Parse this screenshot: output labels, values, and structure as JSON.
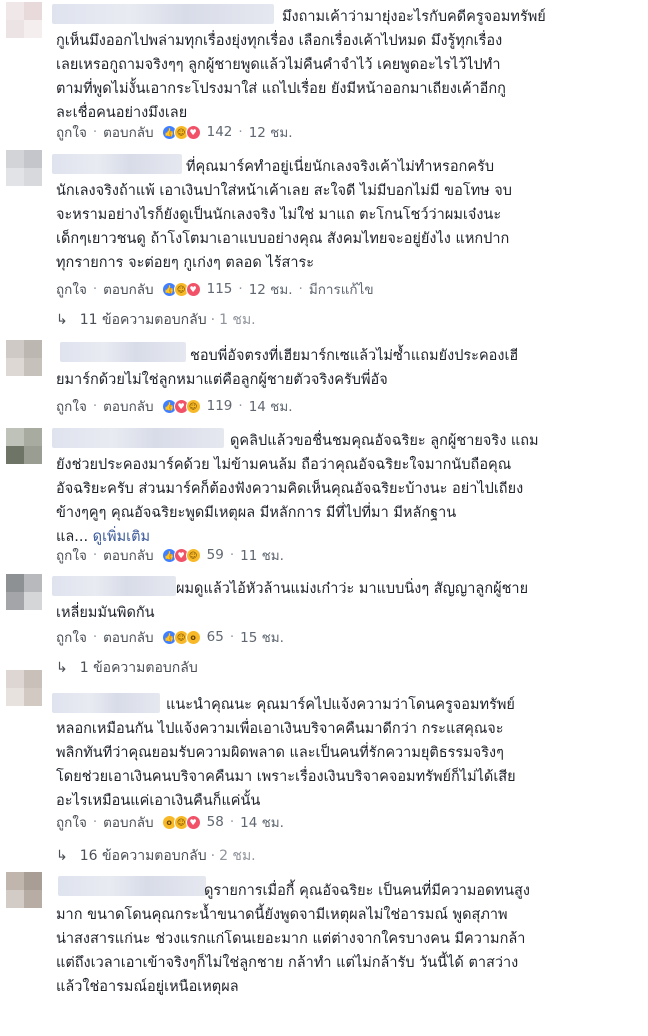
{
  "labels": {
    "like": "ถูกใจ",
    "reply": "ตอบกลับ",
    "dot": "·"
  },
  "comments": [
    {
      "id": "c1",
      "text": "มึงถามเค้าว่ามายุ่งอะไรกับคดีครูจอมทรัพย์\nกูเห็นมึงออกไปพล่ามทุกเรื่องยุ่งทุกเรื่อง เลือกเรื่องเค้าไปหมด มึงรู้ทุกเรื่อง\nเลยเหรอกูถามจริงๆๆ ลูกผู้ชายพูดแล้วไม่คืนคำจำไว้ เคยพูดอะไรไว้ไปทำ\nตามที่พูดไม่งั้นเอากระโปรงมาใส่ แถไปเรื่อย ยังมีหน้าออกมาเถียงเค้าอีกกู\nละเชื่อคนอย่างมึงเลย",
      "reaction_count": "142",
      "time": "12 ชม.",
      "edited": "",
      "avatar_colors": [
        "#f0e8e8",
        "#e8dada",
        "#ece4e4",
        "#f4eeee"
      ]
    },
    {
      "id": "c2",
      "text": "ที่คุณมาร์คทำอยู่เนี่ยนักเลงจริงเค้าไม่ทำหรอกครับ\nนักเลงจริงถ้าแพ้ เอาเงินปาใส่หน้าเค้าเลย สะใจดี ไม่มีบอกไม่มี ขอโทษ จบ\nจะหรามอย่างไรก็ยังดูเป็นนักเลงจริง ไม่ใช่ มาแถ ตะโกนโชว์ว่าผมเจ๋งนะ\nเด็กๆเยาวชนดู ถ้าโงโตมาเอาแบบอย่างคุณ สังคมไทยจะอยู่ยังไง แหกปาก\nทุกรายการ จะต่อยๆ กูเก่งๆ ตลอด ไร้สาระ",
      "reaction_count": "115",
      "time": "12 ชม.",
      "edited": "มีการแก้ไข",
      "avatar_colors": [
        "#d2d4d8",
        "#c4c6cc",
        "#e2e3e6",
        "#d8d9dc"
      ]
    },
    {
      "id": "c3",
      "text": "ชอบพี่อัจตรงที่เฮียมาร์กเซแล้วไม่ซ้ำแถมยังประคองเฮี\nยมาร์กด้วยไม่ใช่ลูกหมาแต่คือลูกผู้ชายตัวจริงครับพี่อัจ",
      "reaction_count": "119",
      "time": "14 ชม.",
      "edited": "",
      "avatar_colors": [
        "#cfcac6",
        "#bdb7b2",
        "#ddd8d4",
        "#c7c1bc"
      ]
    },
    {
      "id": "c4",
      "text": "ดูคลิปแล้วขอชื่นชมคุณอัจฉริยะ ลูกผู้ชายจริง แถม\nยังช่วยประคองมาร์คด้วย ไม่ข้ามคนล้ม ถือว่าคุณอัจฉริยะใจมากนับถือคุณ\nอัจฉริยะครับ ส่วนมาร์คก็ต้องฟังความคิดเห็นคุณอัจฉริยะบ้างนะ อย่าไปเถียง\nข้างๆคูๆ คุณอัจฉริยะพูดมีเหตุผล มีหลักการ มีที่ไปที่มา มีหลักฐาน\nแล... ",
      "see_more": "ดูเพิ่มเติม",
      "reaction_count": "59",
      "time": "11 ชม.",
      "edited": "",
      "avatar_colors": [
        "#bfc2b9",
        "#a8ab9f",
        "#6e7466",
        "#9a9d92"
      ]
    },
    {
      "id": "c5",
      "text": "ผมดูแล้วไอ้หัวล้านแม่งเก๋าว่ะ มาแบบนิ่งๆ สัญญาลูกผู้ชาย\nเหลี่ยมมันพิดกัน",
      "reaction_count": "65",
      "time": "15 ชม.",
      "edited": "",
      "avatar_colors": [
        "#8e9194",
        "#b7b9bc",
        "#a3a5a8",
        "#d5d6d8"
      ]
    },
    {
      "id": "c6",
      "text": "แนะนำคุณนะ คุณมาร์คไปแจ้งความว่าโดนครูจอมทรัพย์\nหลอกเหมือนกัน ไปแจ้งความเพื่อเอาเงินบริจาคคืนมาดีกว่า กระแสคุณจะ\nพลิกทันทีว่าคุณยอมรับความผิดพลาด และเป็นคนที่รักความยุติธรรมจริงๆ\nโดยช่วยเอาเงินคนบริจาคคืนมา เพราะเรื่องเงินบริจาคจอมทรัพย์ก็ไม่ได้เสีย\nอะไรเหมือนแค่เอาเงินคืนก็แค่นั้น",
      "reaction_count": "58",
      "time": "14 ชม.",
      "edited": "",
      "avatar_colors": [
        "#ddd6d2",
        "#c9c0ba",
        "#e8e2de",
        "#d2c9c3"
      ]
    },
    {
      "id": "c7",
      "text": "ดูรายการเมื่อกี้ คุณอัจฉริยะ เป็นคนที่มีความอดทนสูง\nมาก ขนาดโดนคุณกระน้ำขนาดนี้ยังพูดจามีเหตุผลไม่ใช่อารมณ์ พูดสุภาพ\nน่าสงสารแก่นะ ช่วงแรกแก่โดนเยอะมาก แต่ต่างจากใครบางคน มีความกล้า\nแต่ถึงเวลาเอาเข้าจริงๆก็ไม่ใช่ลูกชาย กล้าทำ แต่ไม่กล้ารับ วันนี้ได้ ตาสว่าง\nแล้วใช่อารมณ์อยู่เหนือเหตุผล",
      "reaction_count": "",
      "time": "",
      "edited": "",
      "avatar_colors": [
        "#c0b6ae",
        "#a99e95",
        "#d3cbc5",
        "#b8ada5"
      ]
    }
  ],
  "reply_threads": [
    {
      "count_label": "11 ข้อความตอบกลับ",
      "time": "1 ชม."
    },
    {
      "count_label": "1 ข้อความตอบกลับ",
      "time": ""
    },
    {
      "count_label": "16 ข้อความตอบกลับ",
      "time": "2 ชม."
    }
  ]
}
